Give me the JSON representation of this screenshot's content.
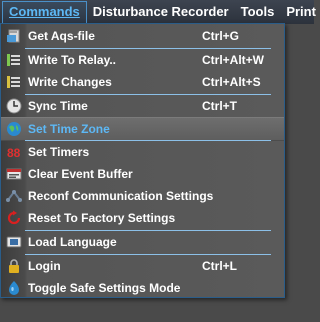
{
  "menubar": {
    "items": [
      {
        "label": "Commands"
      },
      {
        "label": "Disturbance Recorder"
      },
      {
        "label": "Tools"
      },
      {
        "label": "Print"
      }
    ]
  },
  "menu": {
    "items": [
      {
        "label": "Get Aqs-file",
        "shortcut": "Ctrl+G",
        "icon": "file-icon"
      },
      {
        "label": "Write To Relay..",
        "shortcut": "Ctrl+Alt+W",
        "icon": "write-icon"
      },
      {
        "label": "Write Changes",
        "shortcut": "Ctrl+Alt+S",
        "icon": "list-icon"
      },
      {
        "label": "Sync Time",
        "shortcut": "Ctrl+T",
        "icon": "clock-icon"
      },
      {
        "label": "Set Time Zone",
        "shortcut": "",
        "icon": "globe-icon"
      },
      {
        "label": "Set Timers",
        "shortcut": "",
        "icon": "timer-icon"
      },
      {
        "label": "Clear Event Buffer",
        "shortcut": "",
        "icon": "buffer-icon"
      },
      {
        "label": "Reconf Communication Settings",
        "shortcut": "",
        "icon": "network-icon"
      },
      {
        "label": "Reset To Factory Settings",
        "shortcut": "",
        "icon": "reset-icon"
      },
      {
        "label": "Load Language",
        "shortcut": "",
        "icon": "language-icon"
      },
      {
        "label": "Login",
        "shortcut": "Ctrl+L",
        "icon": "lock-icon"
      },
      {
        "label": "Toggle Safe Settings Mode",
        "shortcut": "",
        "icon": "shield-icon"
      }
    ]
  },
  "colors": {
    "accent": "#5db8f5",
    "menu_background": "#5a5a5a",
    "highlight_background": "#6a6a6a",
    "separator": "#8cc0e8"
  }
}
